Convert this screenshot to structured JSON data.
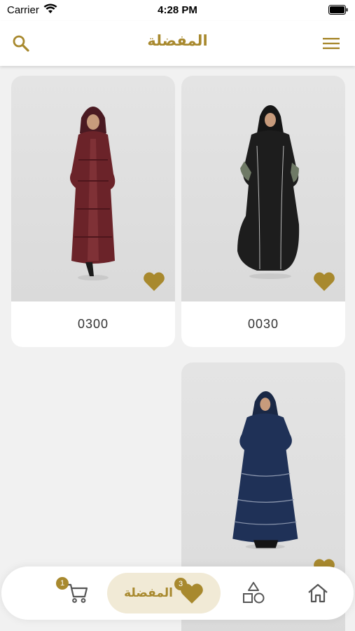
{
  "status_bar": {
    "carrier": "Carrier",
    "time": "4:28 PM"
  },
  "header": {
    "title": "المفضلة",
    "search_icon": "search-icon",
    "menu_icon": "menu-icon"
  },
  "colors": {
    "accent": "#a8892e",
    "accent_light": "#f1ead6",
    "background": "#f1f1f1",
    "card": "#ffffff"
  },
  "products": [
    {
      "code": "0030",
      "favorited": true,
      "garment_color": "#1c1c1c"
    },
    {
      "code": "0300",
      "favorited": true,
      "garment_color": "#5e1f24"
    },
    {
      "code": "",
      "favorited": true,
      "garment_color": "#1f3157"
    }
  ],
  "bottom_nav": {
    "cart": {
      "icon": "cart-icon",
      "badge": "1"
    },
    "favorites": {
      "label": "المفضلة",
      "icon": "heart-icon",
      "badge": "3",
      "active": true
    },
    "categories": {
      "icon": "shapes-icon"
    },
    "home": {
      "icon": "home-icon"
    }
  }
}
